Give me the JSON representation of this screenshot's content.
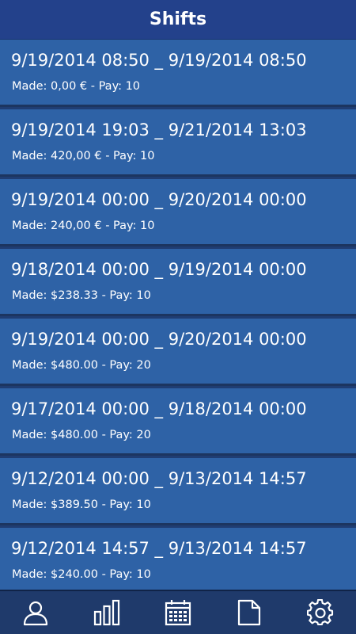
{
  "header": {
    "title": "Shifts"
  },
  "shifts": [
    {
      "range": "9/19/2014 08:50 _ 9/19/2014 08:50",
      "summary": "Made: 0,00 € - Pay: 10"
    },
    {
      "range": "9/19/2014 19:03 _ 9/21/2014 13:03",
      "summary": "Made: 420,00 € - Pay: 10"
    },
    {
      "range": "9/19/2014 00:00 _ 9/20/2014 00:00",
      "summary": "Made: 240,00 € - Pay: 10"
    },
    {
      "range": "9/18/2014 00:00 _ 9/19/2014 00:00",
      "summary": "Made: $238.33 - Pay: 10"
    },
    {
      "range": "9/19/2014 00:00 _ 9/20/2014 00:00",
      "summary": "Made: $480.00 - Pay: 20"
    },
    {
      "range": "9/17/2014 00:00 _ 9/18/2014 00:00",
      "summary": "Made: $480.00 - Pay: 20"
    },
    {
      "range": "9/12/2014 00:00 _ 9/13/2014 14:57",
      "summary": "Made: $389.50 - Pay: 10"
    },
    {
      "range": "9/12/2014 14:57 _ 9/13/2014 14:57",
      "summary": "Made: $240.00 - Pay: 10"
    }
  ],
  "nav": [
    {
      "icon": "user-icon"
    },
    {
      "icon": "bar-chart-icon"
    },
    {
      "icon": "calendar-icon"
    },
    {
      "icon": "document-icon"
    },
    {
      "icon": "gear-icon"
    }
  ],
  "colors": {
    "header_bg": "#23418b",
    "row_bg": "#2e62a6",
    "row_divider": "#1c3560",
    "nav_bg": "#1f3a6b",
    "text": "#ffffff"
  }
}
